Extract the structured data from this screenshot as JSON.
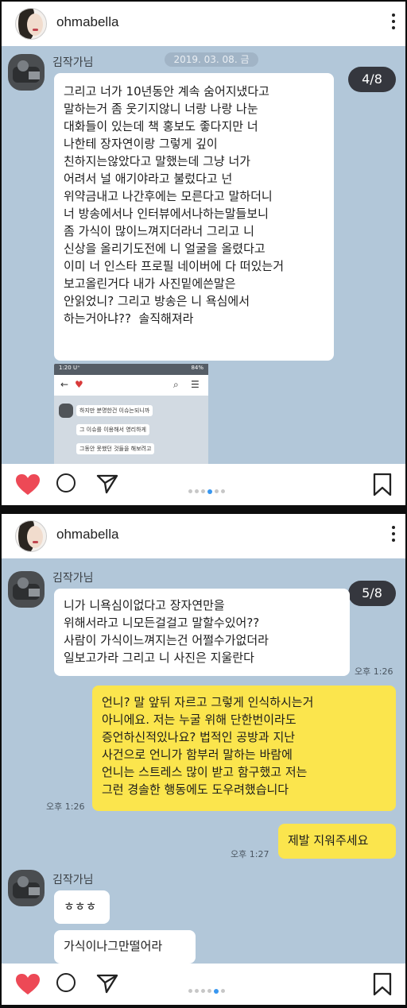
{
  "post1": {
    "username": "ohmabella",
    "sender": "김작가님",
    "date_pill": "2019. 03. 08. 금",
    "counter": "4/8",
    "message": "그리고 너가 10년동안 계속 숨어지냈다고\n말하는거 좀 웃기지않니 너랑 나랑 나눈\n대화들이 있는데 책 홍보도 좋다지만 너\n나한테 장자연이랑 그렇게 깊이\n친하지는않았다고 말했는데 그냥 너가\n어려서 널 애기야라고 불렀다고 넌\n위약금내고 나간후에는 모른다고 말하더니\n너 방송에서나 인터뷰에서나하는말들보니\n좀 가식이 많이느껴지더라너 그리고 니\n신상을 올리기도전에 니 얼굴을 올렸다고\n이미 너 인스타 프로필 네이버에 다 떠있는거\n보고올린거다 내가 사진밑에쓴말은\n안읽었니? 그리고 방송은 니 욕심에서\n하는거아냐??  솔직해져라",
    "embedded": {
      "status_time": "1:20 U⁺",
      "status_right": "84%",
      "bubbles": [
        "하지만 분명한건 이슈는되니까",
        "그 이슈를 이용해서 영리하게",
        "그동안 못했던 것들을 해보려고"
      ]
    }
  },
  "post2": {
    "username": "ohmabella",
    "sender": "김작가님",
    "counter": "5/8",
    "msg1": "니가 니욕심이없다고 장자연만을\n위해서라고 니모든걸걸고 말할수있어??\n사람이 가식이느껴지는건 어쩔수가없더라\n일보고가라 그리고 니 사진은 지울란다",
    "time1": "오후 1:26",
    "my1": "언니? 말 앞뒤 자르고 그렇게 인식하시는거\n아니에요. 저는 누굴 위해 단한번이라도\n증언하신적있나요? 법적인 공방과 지난\n사건으로 언니가 함부러 말하는 바람에\n언니는 스트레스 많이 받고 함구했고 저는\n그런 경솔한 행동에도 도우려했습니다",
    "time2": "오후 1:26",
    "my2": "제발 지워주세요",
    "time3": "오후 1:27",
    "sender2": "김작가님",
    "msg2": "ㅎㅎㅎ",
    "msg3": "가식이나그만떨어라"
  },
  "icons": [
    "heart-icon",
    "comment-icon",
    "share-icon",
    "bookmark-icon",
    "more-icon"
  ],
  "colors": {
    "chat_bg": "#b2c7d9",
    "yellow_bubble": "#fbe54d",
    "heart": "#ed4956",
    "dot_active": "#3897f0"
  }
}
